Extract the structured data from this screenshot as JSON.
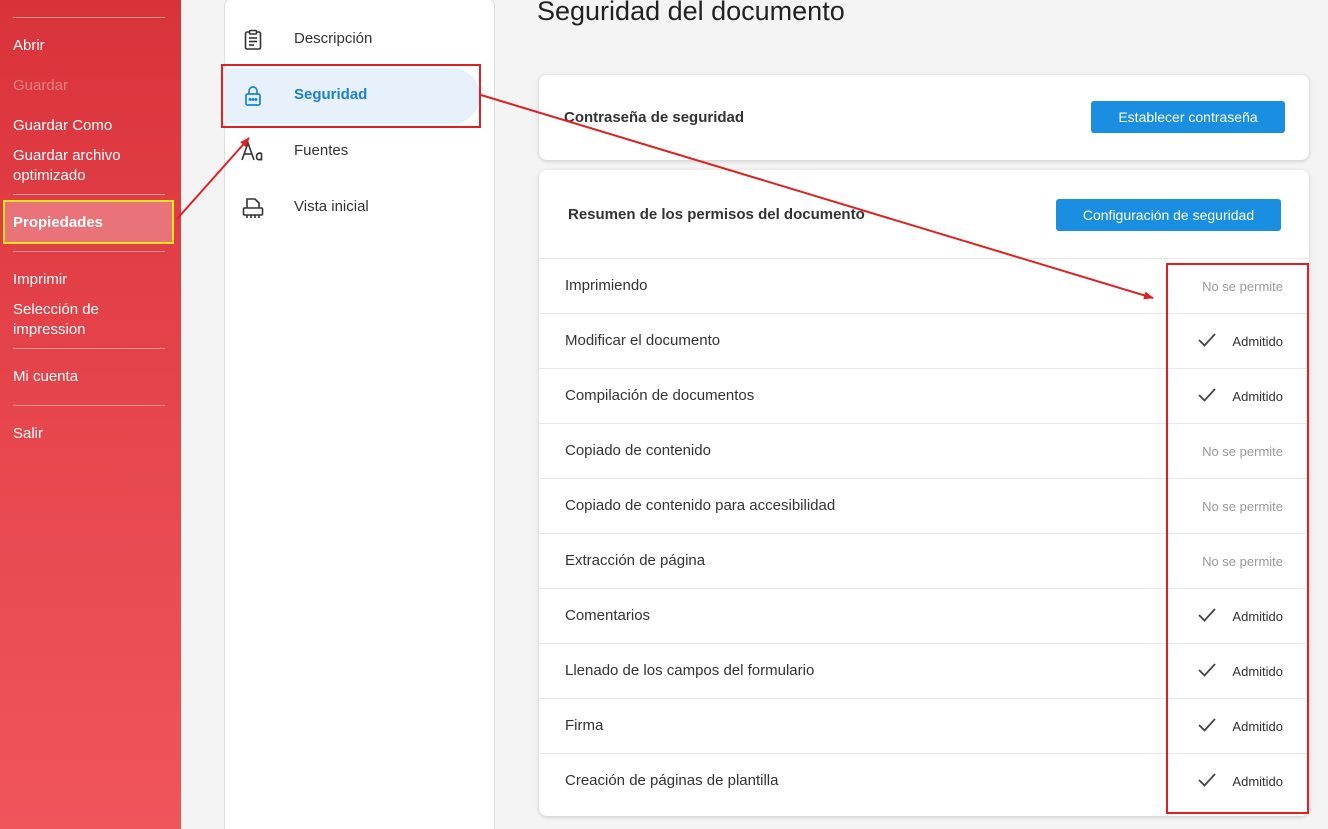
{
  "sidebar": {
    "items": [
      {
        "label": "Abrir",
        "state": "normal"
      },
      {
        "label": "Guardar",
        "state": "disabled"
      },
      {
        "label": "Guardar Como",
        "state": "normal"
      },
      {
        "label": "Guardar archivo optimizado",
        "state": "normal"
      },
      {
        "label": "Propiedades",
        "state": "active"
      },
      {
        "label": "Imprimir",
        "state": "normal"
      },
      {
        "label": "Selección de impression",
        "state": "normal"
      },
      {
        "label": "Mi cuenta",
        "state": "normal"
      },
      {
        "label": "Salir",
        "state": "normal"
      }
    ],
    "colors": {
      "gradient_top": "#d9333a",
      "gradient_bottom": "#f0555a",
      "highlight_border": "#f5e51a"
    }
  },
  "nav": {
    "items": [
      {
        "label": "Descripción",
        "icon": "clipboard-icon"
      },
      {
        "label": "Seguridad",
        "icon": "lock-icon",
        "active": true
      },
      {
        "label": "Fuentes",
        "icon": "font-icon"
      },
      {
        "label": "Vista inicial",
        "icon": "printer-icon"
      }
    ]
  },
  "main": {
    "title": "Seguridad del documento",
    "password_card": {
      "title": "Contraseña de seguridad",
      "button": "Establecer contraseña"
    },
    "permissions_card": {
      "title": "Resumen de los permisos del documento",
      "button": "Configuración de seguridad",
      "rows": [
        {
          "name": "Imprimiendo",
          "status": "No se permite",
          "allowed": false
        },
        {
          "name": "Modificar el documento",
          "status": "Admitido",
          "allowed": true
        },
        {
          "name": "Compilación de documentos",
          "status": "Admitido",
          "allowed": true
        },
        {
          "name": "Copiado de contenido",
          "status": "No se permite",
          "allowed": false
        },
        {
          "name": "Copiado de contenido para accesibilidad",
          "status": "No se permite",
          "allowed": false
        },
        {
          "name": "Extracción de página",
          "status": "No se permite",
          "allowed": false
        },
        {
          "name": "Comentarios",
          "status": "Admitido",
          "allowed": true
        },
        {
          "name": "Llenado de los campos del formulario",
          "status": "Admitido",
          "allowed": true
        },
        {
          "name": "Firma",
          "status": "Admitido",
          "allowed": true
        },
        {
          "name": "Creación de páginas de plantilla",
          "status": "Admitido",
          "allowed": true
        }
      ]
    }
  },
  "colors": {
    "accent": "#1a8ee0",
    "annotation": "#e02020"
  }
}
